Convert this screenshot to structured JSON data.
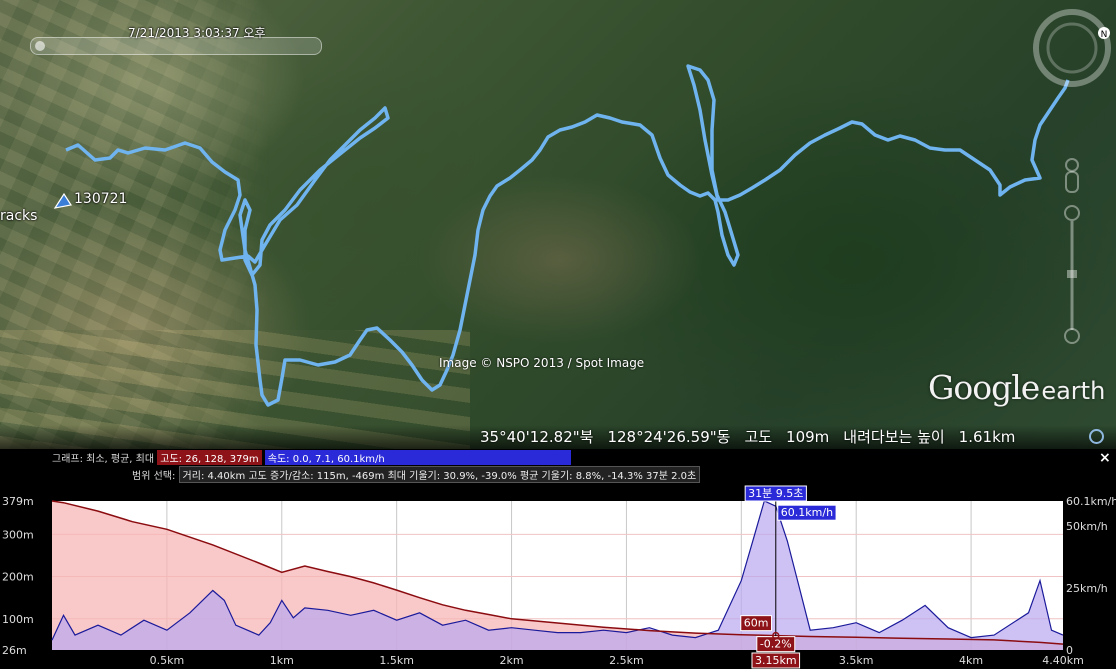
{
  "map": {
    "timestamp": "7/21/2013   3:03:37 오후",
    "placemark_name": "130721",
    "tracks_label": "racks",
    "attribution": "Image © NSPO 2013 / Spot Image",
    "logo_google": "Google",
    "logo_earth": "earth",
    "status": {
      "lat": "35°40'12.82\"북",
      "lon": "128°24'26.59\"동",
      "elev_label": "고도",
      "elev_value": "109m",
      "eye_label": "내려다보는 높이",
      "eye_value": "1.61km"
    },
    "track_color": "#6fb3ef"
  },
  "profile": {
    "graph_label": "그래프: 최소, 평균, 최대",
    "elevation_stats": "고도: 26, 128, 379m",
    "speed_stats": "속도: 0.0, 7.1, 60.1km/h",
    "range_label": "범위 선택:",
    "range_stats": "거리: 4.40km 고도 증가/감소: 115m, -469m 최대 기울기: 30.9%, -39.0% 평균 기울기: 8.8%, -14.3% 37분 2.0초",
    "close": "×",
    "cursor": {
      "time": "31분 9.5초",
      "speed": "60.1km/h",
      "elevation": "60m",
      "slope": "-0.2%",
      "distance": "3.15km"
    }
  },
  "chart_data": {
    "type": "area",
    "xlabel": "",
    "x_ticks": [
      "0.5km",
      "1km",
      "1.5km",
      "2km",
      "2.5km",
      "3km",
      "3.5km",
      "4km",
      "4.40km"
    ],
    "xlim": [
      0,
      4.4
    ],
    "y_left_ticks": [
      "379m",
      "300m",
      "200m",
      "100m",
      "26m"
    ],
    "y_left_range": [
      26,
      379
    ],
    "y_right_ticks": [
      "60.1km/h",
      "50km/h",
      "25km/h",
      "0"
    ],
    "y_right_range": [
      0,
      60.1
    ],
    "elevation_color": "#8b0c10",
    "speed_color": "#1a1a9a",
    "series": [
      {
        "name": "고도",
        "x": [
          0,
          0.05,
          0.2,
          0.35,
          0.5,
          0.7,
          0.9,
          1.0,
          1.1,
          1.2,
          1.3,
          1.4,
          1.5,
          1.6,
          1.7,
          1.8,
          1.9,
          2.0,
          2.2,
          2.4,
          2.6,
          2.8,
          3.0,
          3.15,
          3.3,
          3.5,
          3.7,
          3.9,
          4.1,
          4.3,
          4.4
        ],
        "values": [
          379,
          375,
          355,
          330,
          312,
          275,
          232,
          210,
          225,
          212,
          200,
          185,
          168,
          150,
          133,
          120,
          110,
          100,
          90,
          80,
          72,
          66,
          62,
          60,
          58,
          56,
          54,
          52,
          50,
          44,
          40
        ]
      },
      {
        "name": "속도",
        "x": [
          0,
          0.05,
          0.1,
          0.2,
          0.3,
          0.4,
          0.5,
          0.6,
          0.7,
          0.75,
          0.8,
          0.9,
          0.95,
          1.0,
          1.05,
          1.1,
          1.2,
          1.3,
          1.4,
          1.5,
          1.6,
          1.7,
          1.8,
          1.9,
          2.0,
          2.1,
          2.2,
          2.3,
          2.4,
          2.5,
          2.6,
          2.7,
          2.8,
          2.9,
          3.0,
          3.05,
          3.1,
          3.15,
          3.2,
          3.25,
          3.3,
          3.4,
          3.5,
          3.6,
          3.7,
          3.8,
          3.9,
          4.0,
          4.1,
          4.2,
          4.25,
          4.3,
          4.35,
          4.4
        ],
        "values": [
          4,
          14,
          6,
          10,
          6,
          12,
          8,
          15,
          24,
          20,
          10,
          6,
          11,
          20,
          13,
          17,
          16,
          14,
          16,
          12,
          15,
          10,
          12,
          8,
          9,
          8,
          7,
          7,
          8,
          7,
          9,
          6,
          5,
          8,
          28,
          44,
          60.1,
          58,
          44,
          26,
          8,
          9,
          11,
          7,
          12,
          18,
          9,
          5,
          6,
          12,
          15,
          28,
          8,
          6
        ]
      }
    ]
  }
}
